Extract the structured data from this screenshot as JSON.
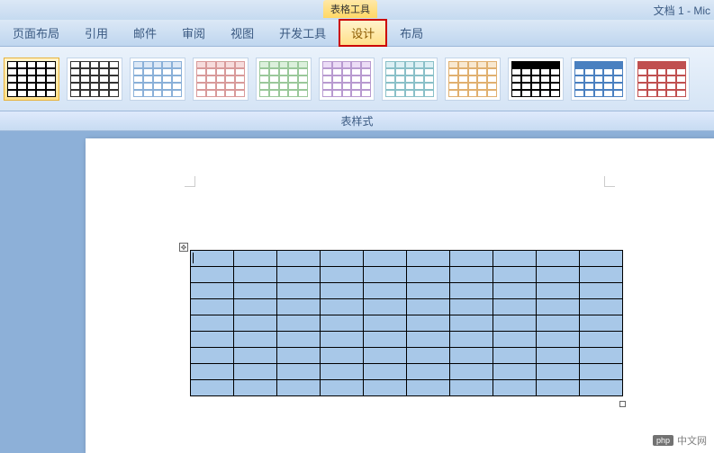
{
  "titlebar": {
    "contextual_tab": "表格工具",
    "doc_title": "文档 1 - Mic"
  },
  "tabs": [
    {
      "label": "页面布局",
      "active": false
    },
    {
      "label": "引用",
      "active": false
    },
    {
      "label": "邮件",
      "active": false
    },
    {
      "label": "审阅",
      "active": false
    },
    {
      "label": "视图",
      "active": false
    },
    {
      "label": "开发工具",
      "active": false
    },
    {
      "label": "设计",
      "active": true
    },
    {
      "label": "布局",
      "active": false
    }
  ],
  "ribbon": {
    "group_label": "表样式",
    "styles": [
      {
        "name": "plain-black",
        "border": "#000",
        "fill": "#fff",
        "header": "#fff",
        "selected": true
      },
      {
        "name": "dashed-black",
        "border": "#333",
        "fill": "#fff",
        "header": "#fff",
        "selected": false
      },
      {
        "name": "light-blue",
        "border": "#8ab0d8",
        "fill": "#fff",
        "header": "#dce8f6",
        "selected": false
      },
      {
        "name": "light-red",
        "border": "#d89a9a",
        "fill": "#fff",
        "header": "#f6dcdc",
        "selected": false
      },
      {
        "name": "light-green",
        "border": "#9ac89a",
        "fill": "#fff",
        "header": "#dcf0dc",
        "selected": false
      },
      {
        "name": "light-purple",
        "border": "#b89ad0",
        "fill": "#fff",
        "header": "#ecdcf6",
        "selected": false
      },
      {
        "name": "light-teal",
        "border": "#8ac0c8",
        "fill": "#fff",
        "header": "#dcf0f4",
        "selected": false
      },
      {
        "name": "light-orange",
        "border": "#e0b070",
        "fill": "#fff",
        "header": "#f8e8d0",
        "selected": false
      },
      {
        "name": "dark-header",
        "border": "#000",
        "fill": "#fff",
        "header": "#000",
        "selected": false
      },
      {
        "name": "blue-header",
        "border": "#4a80c0",
        "fill": "#fff",
        "header": "#4a80c0",
        "selected": false
      },
      {
        "name": "red-header",
        "border": "#c05050",
        "fill": "#fff",
        "header": "#c05050",
        "selected": false
      }
    ]
  },
  "document": {
    "table": {
      "rows": 9,
      "cols": 10,
      "cell_fill": "#a8c8e8"
    },
    "move_handle_glyph": "✥"
  },
  "watermark": {
    "badge": "php",
    "text": "中文网"
  }
}
